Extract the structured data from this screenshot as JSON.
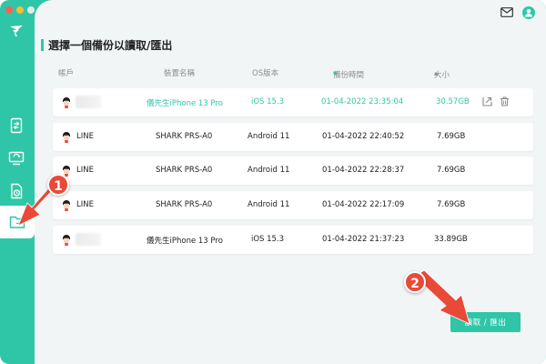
{
  "header": {
    "title": "選擇一個備份以讀取/匯出"
  },
  "table": {
    "columns": [
      "帳戶",
      "裝置名稱",
      "OS版本",
      "備份時間",
      "大小"
    ],
    "sort_indicators": {
      "time": "▾",
      "size": "▴"
    },
    "rows": [
      {
        "account": "",
        "device": "儀先生iPhone 13 Pro",
        "os": "iOS 15.3",
        "time": "01-04-2022 23:35:04",
        "size": "30.57GB"
      },
      {
        "account": "LINE",
        "device": "SHARK PRS-A0",
        "os": "Android 11",
        "time": "01-04-2022 22:40:52",
        "size": "7.69GB"
      },
      {
        "account": "LINE",
        "device": "SHARK PRS-A0",
        "os": "Android 11",
        "time": "01-04-2022 22:28:37",
        "size": "7.69GB"
      },
      {
        "account": "LINE",
        "device": "SHARK PRS-A0",
        "os": "Android 11",
        "time": "01-04-2022 22:17:09",
        "size": "7.69GB"
      },
      {
        "account": "",
        "device": "儀先生iPhone 13 Pro",
        "os": "iOS 15.3",
        "time": "01-04-2022 21:37:23",
        "size": "33.89GB"
      }
    ]
  },
  "footer": {
    "primary_label": "讀取 / 匯出"
  },
  "annotations": {
    "badge_1": "1",
    "badge_2": "2"
  },
  "colors": {
    "accent": "#2fc6a7",
    "annotation": "#e94a38"
  },
  "icons": {
    "sidebar": [
      "phone-transfer-icon",
      "device-sync-icon",
      "backup-icon",
      "restore-folder-icon"
    ],
    "top": [
      "mail-icon",
      "user-icon"
    ],
    "row_actions": [
      "export-icon",
      "trash-icon"
    ]
  }
}
